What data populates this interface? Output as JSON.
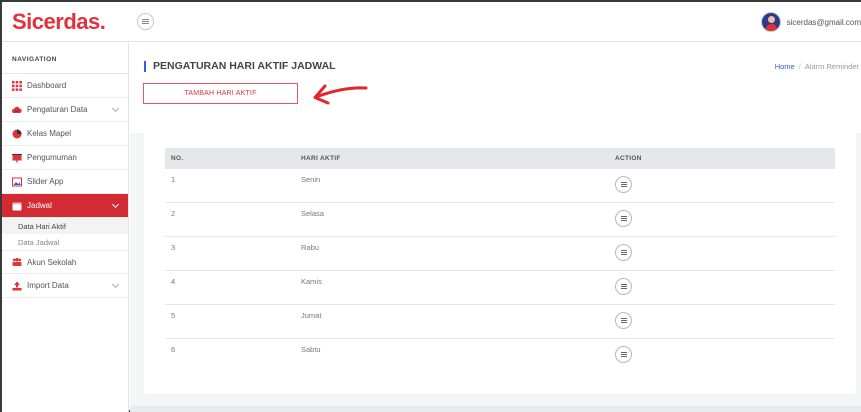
{
  "app": {
    "brand": "Sicerdas."
  },
  "user": {
    "email": "sicerdas@gmail.com"
  },
  "sidebar": {
    "title": "NAVIGATION",
    "items": [
      {
        "label": "Dashboard",
        "icon": "grid-icon",
        "color": "#e1323b"
      },
      {
        "label": "Pengaturan Data",
        "icon": "cloud-icon",
        "color": "#e1323b",
        "has_submenu": true
      },
      {
        "label": "Kelas Mapel",
        "icon": "pie-chart-icon",
        "color": "#e1323b"
      },
      {
        "label": "Pengumuman",
        "icon": "presentation-icon",
        "color": "#e1323b"
      },
      {
        "label": "Slider App",
        "icon": "image-icon",
        "color": "#e1323b"
      },
      {
        "label": "Jadwal",
        "icon": "calendar-icon",
        "color": "#ffffff",
        "active": true,
        "has_submenu": true
      },
      {
        "label": "Akun Sekolah",
        "icon": "users-icon",
        "color": "#e1323b"
      },
      {
        "label": "Import Data",
        "icon": "upload-icon",
        "color": "#e1323b",
        "has_submenu": true
      }
    ],
    "subitems": [
      {
        "label": "Data Hari Aktif",
        "current": true
      },
      {
        "label": "Data Jadwal",
        "current": false
      }
    ]
  },
  "page": {
    "title": "PENGATURAN HARI AKTIF JADWAL",
    "breadcrumb": {
      "home": "Home",
      "separator": "/",
      "current": "Alarm Reminder"
    },
    "add_button": "TAMBAH HARI AKTIF"
  },
  "table": {
    "headers": [
      "NO.",
      "HARI AKTIF",
      "ACTION"
    ],
    "rows": [
      {
        "no": "1",
        "day": "Senin"
      },
      {
        "no": "2",
        "day": "Selasa"
      },
      {
        "no": "3",
        "day": "Rabu"
      },
      {
        "no": "4",
        "day": "Kamis"
      },
      {
        "no": "5",
        "day": "Jumat"
      },
      {
        "no": "6",
        "day": "Sabtu"
      }
    ],
    "action_icon": "menu-icon"
  },
  "colors": {
    "brand": "#e1323b",
    "active_nav": "#d22b33",
    "accent": "#3b5bdb",
    "annotation_arrow": "#e3262d"
  }
}
